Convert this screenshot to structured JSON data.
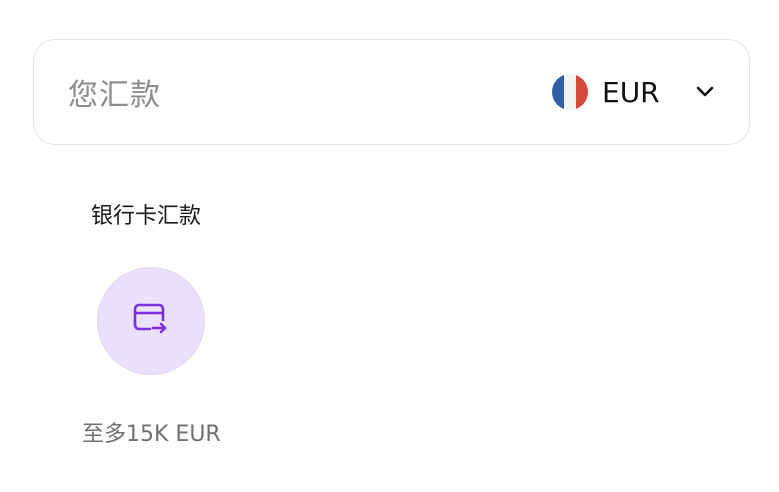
{
  "send_box": {
    "label": "您汇款",
    "currency": {
      "code": "EUR",
      "flag_icon": "france-flag-icon",
      "flag_colors": [
        "#2e5fa5",
        "#f4f4f4",
        "#d64a3a"
      ],
      "dropdown_icon": "chevron-down-icon"
    }
  },
  "payment_method": {
    "title": "银行卡汇款",
    "icon": "card-transfer-icon",
    "icon_color": "#7b2fe0",
    "button_bg": "#ebe0fd",
    "limit": "至多15K EUR"
  }
}
